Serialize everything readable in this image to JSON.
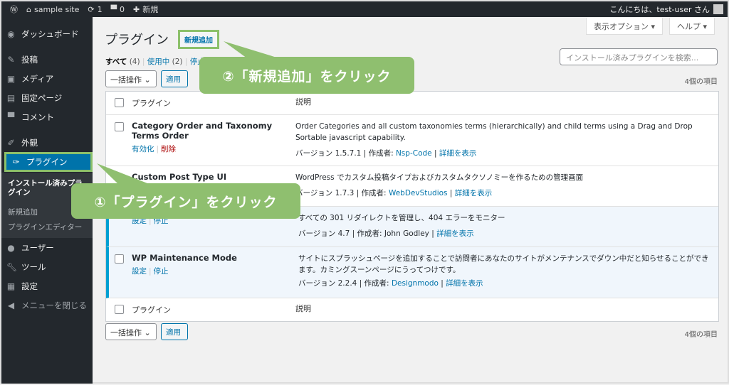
{
  "adminbar": {
    "site": "sample site",
    "updates": "1",
    "comments": "0",
    "new": "新規",
    "greeting": "こんにちは、test-user さん"
  },
  "sidebar": {
    "items": [
      "ダッシュボード",
      "投稿",
      "メディア",
      "固定ページ",
      "コメント",
      "外観",
      "プラグイン",
      "ユーザー",
      "ツール",
      "設定",
      "メニューを閉じる"
    ],
    "submenu": [
      "インストール済みプラグイン",
      "新規追加",
      "プラグインエディター"
    ]
  },
  "header": {
    "title": "プラグイン",
    "add_new": "新規追加",
    "screen_options": "表示オプション ▾",
    "help": "ヘルプ ▾"
  },
  "filters": {
    "all": "すべて",
    "all_count": "(4)",
    "active": "使用中",
    "active_count": "(2)",
    "inactive": "停止"
  },
  "search": {
    "placeholder": "インストール済みプラグインを検索..."
  },
  "bulk": {
    "label": "一括操作",
    "apply": "適用",
    "count": "4個の項目"
  },
  "table": {
    "col_plugin": "プラグイン",
    "col_desc": "説明",
    "rows": [
      {
        "name": "Category Order and Taxonomy Terms Order",
        "actions": [
          "有効化",
          "削除"
        ],
        "desc": "Order Categories and all custom taxonomies terms (hierarchically) and child terms using a Drag and Drop Sortable javascript capability.",
        "version": "バージョン 1.5.7.1 | 作成者: ",
        "author": "Nsp-Code",
        "details": "詳細を表示"
      },
      {
        "name": "Custom Post Type UI",
        "actions": [],
        "desc": "WordPress でカスタム投稿タイプおよびカスタムタクソノミーを作るための管理画面",
        "version": "バージョン 1.7.3 | 作成者: ",
        "author": "WebDevStudios",
        "details": "詳細を表示"
      },
      {
        "name": "",
        "actions": [
          "設定",
          "停止"
        ],
        "desc": "すべての 301 リダイレクトを管理し、404 エラーをモニター",
        "version": "バージョン 4.7 | 作成者: John Godley | ",
        "author": "",
        "details": "詳細を表示"
      },
      {
        "name": "WP Maintenance Mode",
        "actions": [
          "設定",
          "停止"
        ],
        "desc": "サイトにスプラッシュページを追加することで訪問者にあなたのサイトがメンテナンスでダウン中だと知らせることができます。カミングスーンページにうってつけです。",
        "version": "バージョン 2.2.4 | 作成者: ",
        "author": "Designmodo",
        "details": "詳細を表示"
      }
    ]
  },
  "callouts": {
    "one": "①「プラグイン」をクリック",
    "two": "②「新規追加」をクリック"
  },
  "colors": {
    "callout": "#8fbf6f",
    "accent": "#0073aa",
    "dark": "#23282d"
  }
}
